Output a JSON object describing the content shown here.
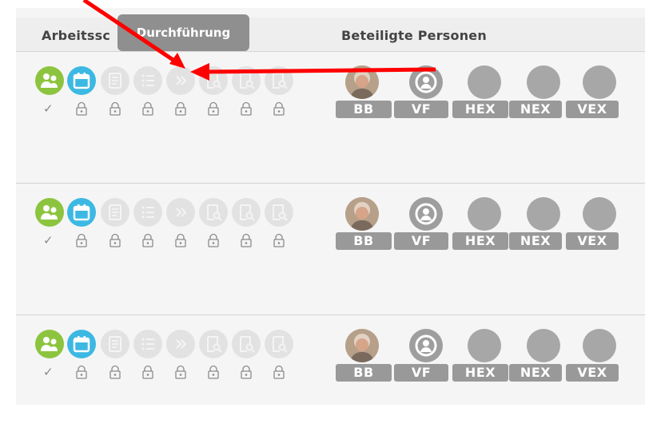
{
  "header": {
    "col1_label": "Arbeitssc",
    "col2_label": "Beteiligte Personen"
  },
  "tooltip": {
    "text": "Durchführung"
  },
  "colors": {
    "green": "#8dc43f",
    "blue": "#3cb8e3",
    "disabled": "#e2e2e2",
    "badge": "#999999",
    "annotation": "#ff0000"
  },
  "steps": [
    {
      "name": "team-icon",
      "state": "done"
    },
    {
      "name": "calendar-icon",
      "state": "active"
    },
    {
      "name": "document-icon",
      "state": "locked"
    },
    {
      "name": "list-icon",
      "state": "locked"
    },
    {
      "name": "forward-icon",
      "state": "locked"
    },
    {
      "name": "document-search-icon",
      "state": "locked"
    },
    {
      "name": "document-search-icon",
      "state": "locked"
    },
    {
      "name": "document-search-icon",
      "state": "locked"
    }
  ],
  "rows": [
    {
      "check": "✓",
      "persons": [
        {
          "code": "BB",
          "avatar": "photo"
        },
        {
          "code": "VF",
          "avatar": "user-icon"
        },
        {
          "code": "HEX",
          "avatar": "empty"
        },
        {
          "code": "NEX",
          "avatar": "empty"
        },
        {
          "code": "VEX",
          "avatar": "empty"
        }
      ]
    },
    {
      "check": "✓",
      "persons": [
        {
          "code": "BB",
          "avatar": "photo"
        },
        {
          "code": "VF",
          "avatar": "user-icon"
        },
        {
          "code": "HEX",
          "avatar": "empty"
        },
        {
          "code": "NEX",
          "avatar": "empty"
        },
        {
          "code": "VEX",
          "avatar": "empty"
        }
      ]
    },
    {
      "check": "✓",
      "persons": [
        {
          "code": "BB",
          "avatar": "photo"
        },
        {
          "code": "VF",
          "avatar": "user-icon"
        },
        {
          "code": "HEX",
          "avatar": "empty"
        },
        {
          "code": "NEX",
          "avatar": "empty"
        },
        {
          "code": "VEX",
          "avatar": "empty"
        }
      ]
    }
  ]
}
